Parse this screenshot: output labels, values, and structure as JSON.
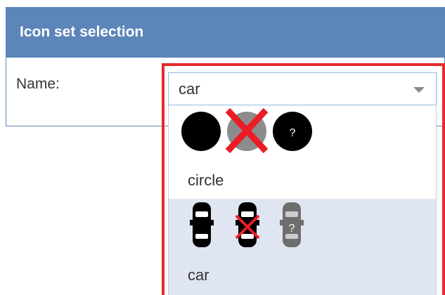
{
  "panel": {
    "title": "Icon set selection",
    "name_label": "Name:"
  },
  "select": {
    "value": "car",
    "icon": "chevron-down-icon"
  },
  "dropdown": {
    "options": [
      {
        "label": "circle",
        "icons": [
          "circle-filled-icon",
          "circle-disabled-icon",
          "circle-unknown-icon"
        ],
        "unknown_mark": "?"
      },
      {
        "label": "car",
        "icons": [
          "car-icon",
          "car-disabled-icon",
          "car-unknown-icon"
        ],
        "unknown_mark": "?"
      }
    ]
  },
  "colors": {
    "header": "#5c85b9",
    "highlight": "#e32b2b",
    "selected_option": "#e0e6f1",
    "cross": "#ec1c24"
  }
}
